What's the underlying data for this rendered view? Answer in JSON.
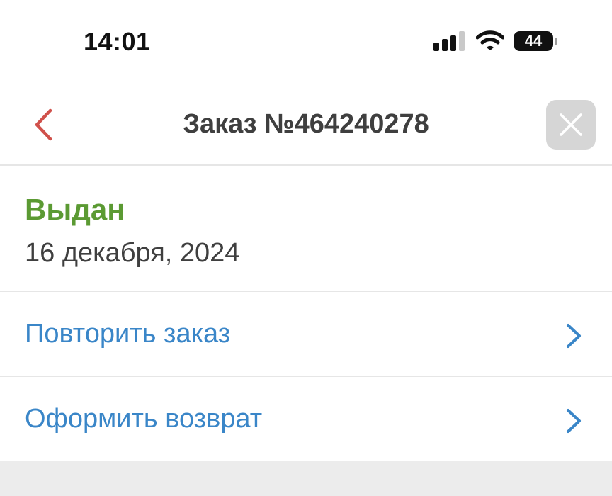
{
  "status_bar": {
    "time": "14:01",
    "battery": "44",
    "icons": [
      "signal-icon",
      "wifi-icon",
      "battery-icon"
    ]
  },
  "header": {
    "title": "Заказ №464240278",
    "back_icon": "chevron-left-icon",
    "close_icon": "close-icon"
  },
  "order": {
    "status": "Выдан",
    "date": "16 декабря, 2024"
  },
  "actions": [
    {
      "label": "Повторить заказ",
      "icon": "chevron-right-icon"
    },
    {
      "label": "Оформить возврат",
      "icon": "chevron-right-icon"
    }
  ],
  "colors": {
    "accent": "#3a86c8",
    "status_green": "#5b9a33",
    "back_arrow": "#d0514b",
    "close_bg": "#d6d6d6",
    "divider": "#e6e6e6"
  }
}
